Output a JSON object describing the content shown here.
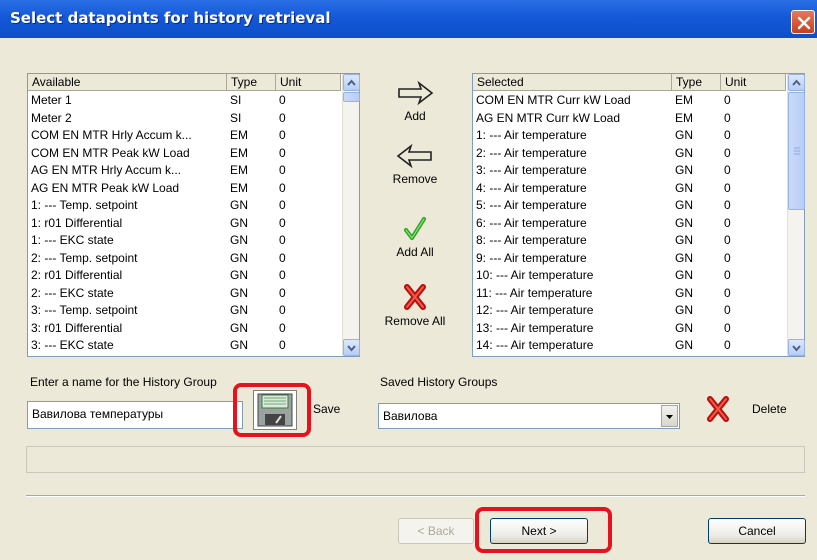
{
  "window": {
    "title": "Select datapoints for history retrieval"
  },
  "available": {
    "columns": [
      "Available",
      "Type",
      "Unit"
    ],
    "rows": [
      [
        "Meter 1",
        "SI",
        "0"
      ],
      [
        "Meter 2",
        "SI",
        "0"
      ],
      [
        "COM EN MTR Hrly Accum k...",
        "EM",
        "0"
      ],
      [
        "COM EN MTR Peak kW Load",
        "EM",
        "0"
      ],
      [
        "AG EN MTR  Hrly Accum k...",
        "EM",
        "0"
      ],
      [
        "AG EN MTR  Peak kW Load",
        "EM",
        "0"
      ],
      [
        "1: --- Temp. setpoint",
        "GN",
        "0"
      ],
      [
        "1: r01 Differential",
        "GN",
        "0"
      ],
      [
        "1: --- EKC state",
        "GN",
        "0"
      ],
      [
        "2: --- Temp. setpoint",
        "GN",
        "0"
      ],
      [
        "2: r01 Differential",
        "GN",
        "0"
      ],
      [
        "2: --- EKC state",
        "GN",
        "0"
      ],
      [
        "3: --- Temp. setpoint",
        "GN",
        "0"
      ],
      [
        "3: r01 Differential",
        "GN",
        "0"
      ],
      [
        "3: --- EKC state",
        "GN",
        "0"
      ]
    ]
  },
  "selected": {
    "columns": [
      "Selected",
      "Type",
      "Unit"
    ],
    "rows": [
      [
        "COM EN MTR Curr kW Load",
        "EM",
        "0"
      ],
      [
        "AG EN MTR  Curr kW Load",
        "EM",
        "0"
      ],
      [
        "1: --- Air temperature",
        "GN",
        "0"
      ],
      [
        "2: --- Air temperature",
        "GN",
        "0"
      ],
      [
        "3: --- Air temperature",
        "GN",
        "0"
      ],
      [
        "4: --- Air temperature",
        "GN",
        "0"
      ],
      [
        "5: --- Air temperature",
        "GN",
        "0"
      ],
      [
        "6: --- Air temperature",
        "GN",
        "0"
      ],
      [
        "8: --- Air temperature",
        "GN",
        "0"
      ],
      [
        "9: --- Air temperature",
        "GN",
        "0"
      ],
      [
        "10: --- Air temperature",
        "GN",
        "0"
      ],
      [
        "11: --- Air temperature",
        "GN",
        "0"
      ],
      [
        "12: --- Air temperature",
        "GN",
        "0"
      ],
      [
        "13: --- Air temperature",
        "GN",
        "0"
      ],
      [
        "14: --- Air temperature",
        "GN",
        "0"
      ]
    ]
  },
  "actions": {
    "add": "Add",
    "remove": "Remove",
    "add_all": "Add All",
    "remove_all": "Remove All"
  },
  "history_group": {
    "name_label": "Enter a name for the History Group",
    "name_value": "Вавилова температуры",
    "save_label": "Save",
    "saved_label": "Saved History Groups",
    "saved_value": "Вавилова",
    "delete_label": "Delete"
  },
  "buttons": {
    "back": "< Back",
    "next": "Next >",
    "cancel": "Cancel"
  },
  "colors": {
    "highlight": "#e8121c",
    "titlebar": "#1458d8"
  }
}
